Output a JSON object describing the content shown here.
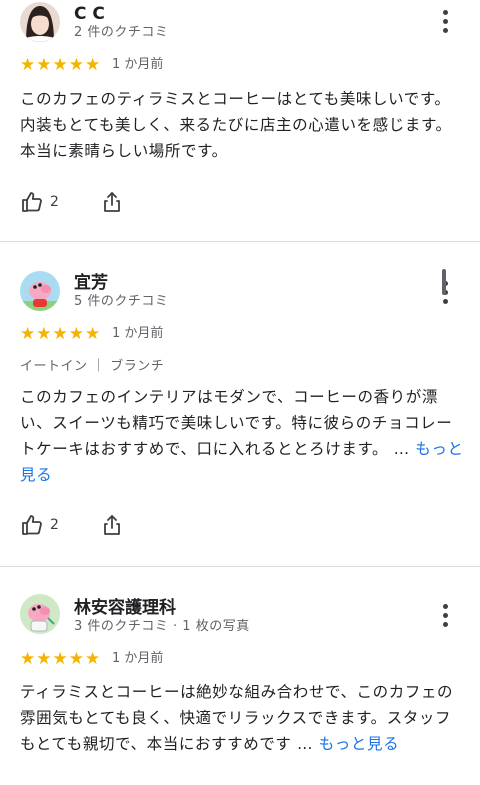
{
  "reviews": [
    {
      "name": "C C",
      "meta": "2 件のクチコミ",
      "time": "1 か月前",
      "tags": "",
      "text": "このカフェのティラミスとコーヒーはとても美味しいです。内装もとても美しく、来るたびに店主の心遣いを感じます。本当に素晴らしい場所です。",
      "more_label": "",
      "likes": "2",
      "rating": 5
    },
    {
      "name": "宜芳",
      "meta": "5 件のクチコミ",
      "time": "1 か月前",
      "tags": "イートイン ｜ ブランチ",
      "text": "このカフェのインテリアはモダンで、コーヒーの香りが漂い、スイーツも精巧で美味しいです。特に彼らのチョコレートケーキはおすすめで、口に入れるととろけます。 …",
      "more_label": "もっと見る",
      "likes": "2",
      "rating": 5
    },
    {
      "name": "林安容護理科",
      "meta": "3 件のクチコミ · 1 枚の写真",
      "time": "1 か月前",
      "tags": "",
      "text": "ティラミスとコーヒーは絶妙な組み合わせで、このカフェの雰囲気もとても良く、快適でリラックスできます。スタッフもとても親切で、本当におすすめです …",
      "more_label": "もっと見る",
      "likes": "",
      "rating": 5
    }
  ],
  "colors": {
    "star": "#f4b400",
    "link": "#1a73e8",
    "text": "#202124",
    "secondary": "#5f6368"
  },
  "icons": {
    "like": "thumbs-up-icon",
    "share": "share-icon",
    "menu": "more-vert-icon",
    "star": "star-icon"
  }
}
